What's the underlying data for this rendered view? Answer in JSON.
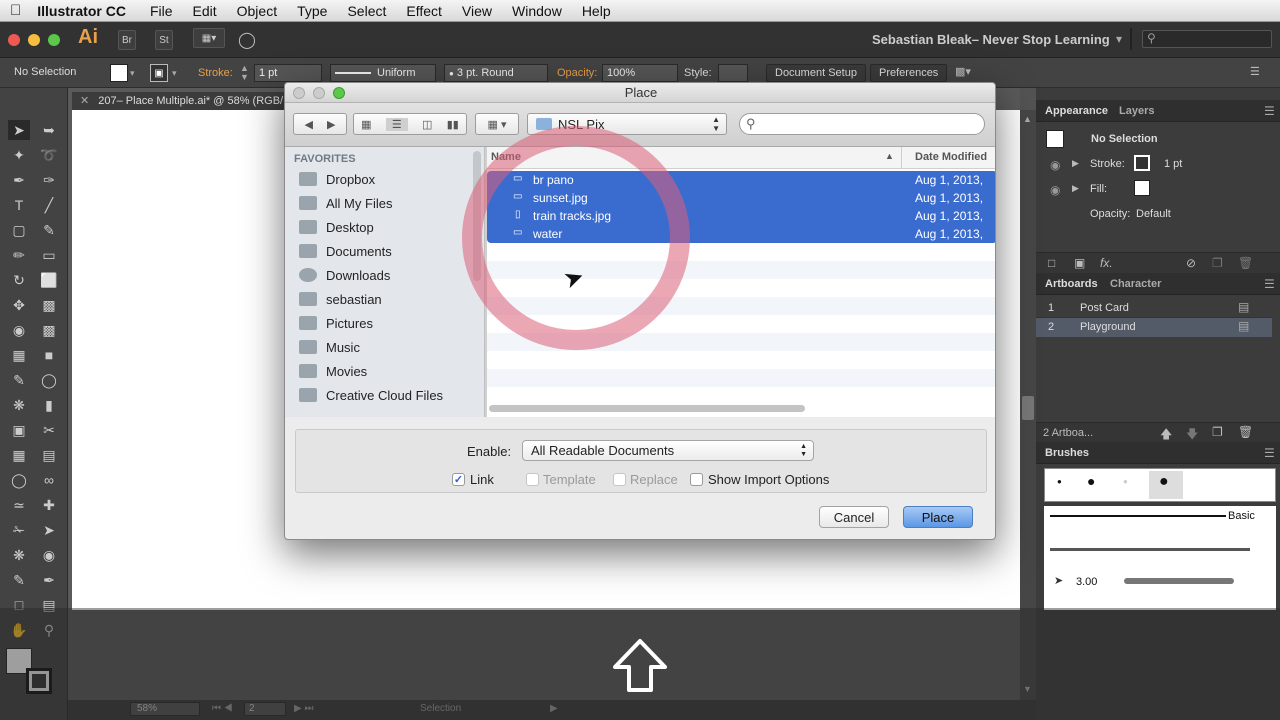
{
  "menubar": {
    "apple_icon": "apple-icon",
    "app_name": "Illustrator CC",
    "items": [
      "File",
      "Edit",
      "Object",
      "Type",
      "Select",
      "Effect",
      "View",
      "Window",
      "Help"
    ]
  },
  "appbar": {
    "logo": "Ai",
    "br": "Br",
    "st": "St",
    "workspace": "Sebastian Bleak– Never Stop Learning"
  },
  "control": {
    "selection": "No Selection",
    "stroke_label": "Stroke:",
    "stroke_value": "1 pt",
    "stroke_style": "Uniform",
    "stroke_profile": "3 pt. Round",
    "opacity_label": "Opacity:",
    "opacity_value": "100%",
    "style_label": "Style:",
    "doc_setup": "Document Setup",
    "preferences": "Preferences"
  },
  "document": {
    "tab": "207– Place Multiple.ai* @ 58% (RGB/..."
  },
  "status": {
    "zoom": "58%",
    "artboard": "2",
    "mode": "Selection"
  },
  "appearance": {
    "tab_active": "Appearance",
    "tab_other": "Layers",
    "title": "No Selection",
    "stroke_label": "Stroke:",
    "stroke_value": "1 pt",
    "fill_label": "Fill:",
    "opacity_label": "Opacity:",
    "opacity_value": "Default",
    "fx": "fx."
  },
  "artboards": {
    "tab_active": "Artboards",
    "tab_other": "Character",
    "rows": [
      {
        "num": "1",
        "name": "Post Card"
      },
      {
        "num": "2",
        "name": "Playground"
      }
    ],
    "footer": "2 Artboa..."
  },
  "brushes": {
    "tab": "Brushes",
    "basic": "Basic",
    "size": "3.00"
  },
  "dialog": {
    "title": "Place",
    "folder": "NSL Pix",
    "search_placeholder": "",
    "favorites_header": "FAVORITES",
    "favorites": [
      "Dropbox",
      "All My Files",
      "Desktop",
      "Documents",
      "Downloads",
      "sebastian",
      "Pictures",
      "Music",
      "Movies",
      "Creative Cloud Files"
    ],
    "col_name": "Name",
    "col_date": "Date Modified",
    "files": [
      {
        "name": "br pano",
        "date": "Aug 1, 2013,"
      },
      {
        "name": "sunset.jpg",
        "date": "Aug 1, 2013,"
      },
      {
        "name": "train tracks.jpg",
        "date": "Aug 1, 2013,"
      },
      {
        "name": "water",
        "date": "Aug 1, 2013,"
      }
    ],
    "enable_label": "Enable:",
    "enable_value": "All Readable Documents",
    "link": "Link",
    "template": "Template",
    "replace": "Replace",
    "show_import": "Show Import Options",
    "cancel": "Cancel",
    "place": "Place"
  },
  "colors": {
    "selection": "#3a6ccf",
    "accent": "#e8a04a",
    "ring": "#dc5f78"
  }
}
